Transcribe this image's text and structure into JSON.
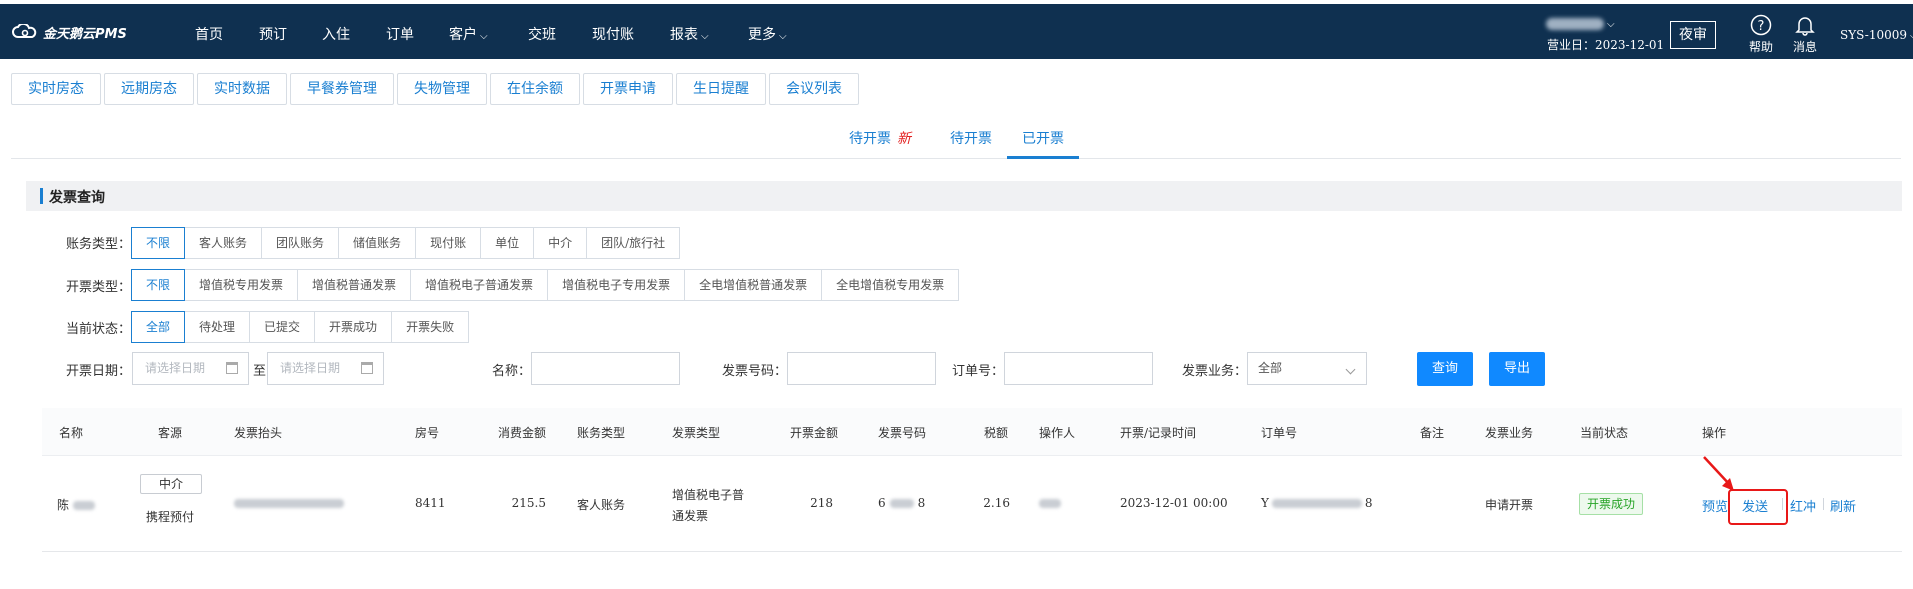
{
  "app": {
    "logo_text": "金天鹅云PMS"
  },
  "nav": [
    {
      "label": "首页",
      "has_caret": false
    },
    {
      "label": "预订",
      "has_caret": false
    },
    {
      "label": "入住",
      "has_caret": false
    },
    {
      "label": "订单",
      "has_caret": false
    },
    {
      "label": "客户",
      "has_caret": true
    },
    {
      "label": "交班",
      "has_caret": false
    },
    {
      "label": "现付账",
      "has_caret": false
    },
    {
      "label": "报表",
      "has_caret": true
    },
    {
      "label": "更多",
      "has_caret": true
    }
  ],
  "header_right": {
    "business_date": "营业日：2023-12-01",
    "night_audit": "夜审",
    "help": "帮助",
    "messages": "消息",
    "user_id": "SYS-10009"
  },
  "func_tabs": [
    "实时房态",
    "远期房态",
    "实时数据",
    "早餐券管理",
    "失物管理",
    "在住余额",
    "开票申请",
    "生日提醒",
    "会议列表"
  ],
  "sub_tabs": {
    "pending_new": "待开票",
    "new_badge": "新",
    "pending": "待开票",
    "issued": "已开票"
  },
  "section_title": "发票查询",
  "filters": {
    "account_type": {
      "label": "账务类型：",
      "options": [
        "不限",
        "客人账务",
        "团队账务",
        "储值账务",
        "现付账",
        "单位",
        "中介",
        "团队/旅行社"
      ],
      "selected": "不限"
    },
    "invoice_type": {
      "label": "开票类型：",
      "options": [
        "不限",
        "增值税专用发票",
        "增值税普通发票",
        "增值税电子普通发票",
        "增值税电子专用发票",
        "全电增值税普通发票",
        "全电增值税专用发票"
      ],
      "selected": "不限"
    },
    "status": {
      "label": "当前状态：",
      "options": [
        "全部",
        "待处理",
        "已提交",
        "开票成功",
        "开票失败"
      ],
      "selected": "全部"
    }
  },
  "search": {
    "date_label": "开票日期：",
    "date_start_placeholder": "请选择日期",
    "date_sep": "至",
    "date_end_placeholder": "请选择日期",
    "name_label": "名称：",
    "invoice_no_label": "发票号码：",
    "order_no_label": "订单号：",
    "business_label": "发票业务：",
    "business_value": "全部",
    "query_button": "查询",
    "export_button": "导出"
  },
  "table": {
    "headers": [
      "名称",
      "客源",
      "发票抬头",
      "房号",
      "消费金额",
      "账务类型",
      "发票类型",
      "开票金额",
      "发票号码",
      "税额",
      "操作人",
      "开票/记录时间",
      "订单号",
      "备注",
      "发票业务",
      "当前状态",
      "操作"
    ],
    "rows": [
      {
        "name": "陈",
        "source_badge": "中介",
        "source": "携程预付",
        "title": "",
        "room": "8411",
        "amount": "215.5",
        "account_type": "客人账务",
        "invoice_type_line1": "增值税电子普",
        "invoice_type_line2": "通发票",
        "invoice_amount": "218",
        "invoice_no_prefix": "6",
        "invoice_no_suffix": "8",
        "tax": "2.16",
        "operator": "",
        "time": "2023-12-01 00:00",
        "order_prefix": "Y",
        "order_suffix": "8",
        "remark": "",
        "business": "申请开票",
        "status": "开票成功",
        "actions": [
          "预览",
          "发送",
          "红冲",
          "刷新"
        ]
      }
    ]
  },
  "colors": {
    "topbar": "#0f3050",
    "primary": "#1089ff",
    "link": "#1a7fd1",
    "success": "#28a428",
    "highlight": "#e81818"
  }
}
